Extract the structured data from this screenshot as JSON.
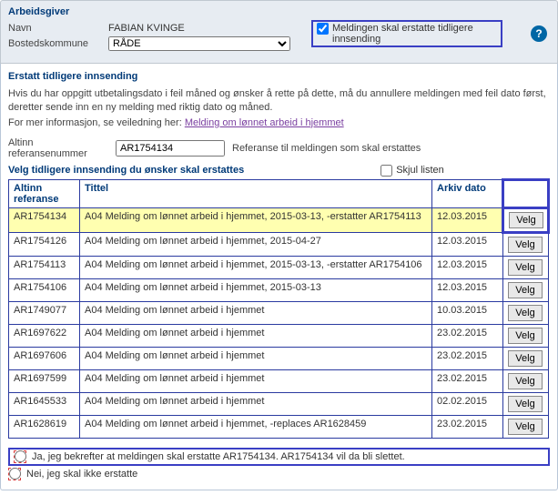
{
  "arbeidsgiver": {
    "heading": "Arbeidsgiver",
    "navn_label": "Navn",
    "navn_value": "FABIAN KVINGE",
    "kommune_label": "Bostedskommune",
    "kommune_value": "RÅDE",
    "replace_checkbox_label": "Meldingen skal erstatte tidligere innsending"
  },
  "erstatt": {
    "heading": "Erstatt tidligere innsending",
    "line1": "Hvis du har oppgitt utbetalingsdato i feil måned og ønsker å rette på dette, må du annullere meldingen med feil dato først, deretter sende inn en ny melding med riktig dato og måned.",
    "line2_prefix": "For mer informasjon, se veiledning her: ",
    "line2_link": "Melding om lønnet arbeid i hjemmet",
    "ref_label": "Altinn referansenummer",
    "ref_value": "AR1754134",
    "ref_hint": "Referanse til meldingen som skal erstattes"
  },
  "listheader": {
    "title": "Velg tidligere innsending du ønsker skal erstattes",
    "skjul": "Skjul listen"
  },
  "table": {
    "col_ref": "Altinn referanse",
    "col_title": "Tittel",
    "col_date": "Arkiv dato",
    "velg_label": "Velg",
    "rows": [
      {
        "ref": "AR1754134",
        "title": "A04 Melding om lønnet arbeid i hjemmet, 2015-03-13, -erstatter AR1754113",
        "date": "12.03.2015",
        "hl": true
      },
      {
        "ref": "AR1754126",
        "title": "A04 Melding om lønnet arbeid i hjemmet, 2015-04-27",
        "date": "12.03.2015"
      },
      {
        "ref": "AR1754113",
        "title": "A04 Melding om lønnet arbeid i hjemmet, 2015-03-13, -erstatter AR1754106",
        "date": "12.03.2015"
      },
      {
        "ref": "AR1754106",
        "title": "A04 Melding om lønnet arbeid i hjemmet, 2015-03-13",
        "date": "12.03.2015"
      },
      {
        "ref": "AR1749077",
        "title": "A04 Melding om lønnet arbeid i hjemmet",
        "date": "10.03.2015"
      },
      {
        "ref": "AR1697622",
        "title": "A04 Melding om lønnet arbeid i hjemmet",
        "date": "23.02.2015"
      },
      {
        "ref": "AR1697606",
        "title": "A04 Melding om lønnet arbeid i hjemmet",
        "date": "23.02.2015"
      },
      {
        "ref": "AR1697599",
        "title": "A04 Melding om lønnet arbeid i hjemmet",
        "date": "23.02.2015"
      },
      {
        "ref": "AR1645533",
        "title": "A04 Melding om lønnet arbeid i hjemmet",
        "date": "02.02.2015"
      },
      {
        "ref": "AR1628619",
        "title": "A04 Melding om lønnet arbeid i hjemmet, -replaces AR1628459",
        "date": "23.02.2015"
      }
    ]
  },
  "confirm": {
    "yes": "Ja, jeg bekrefter at meldingen skal erstatte AR1754134. AR1754134 vil da bli slettet.",
    "no": "Nei, jeg skal ikke erstatte"
  }
}
